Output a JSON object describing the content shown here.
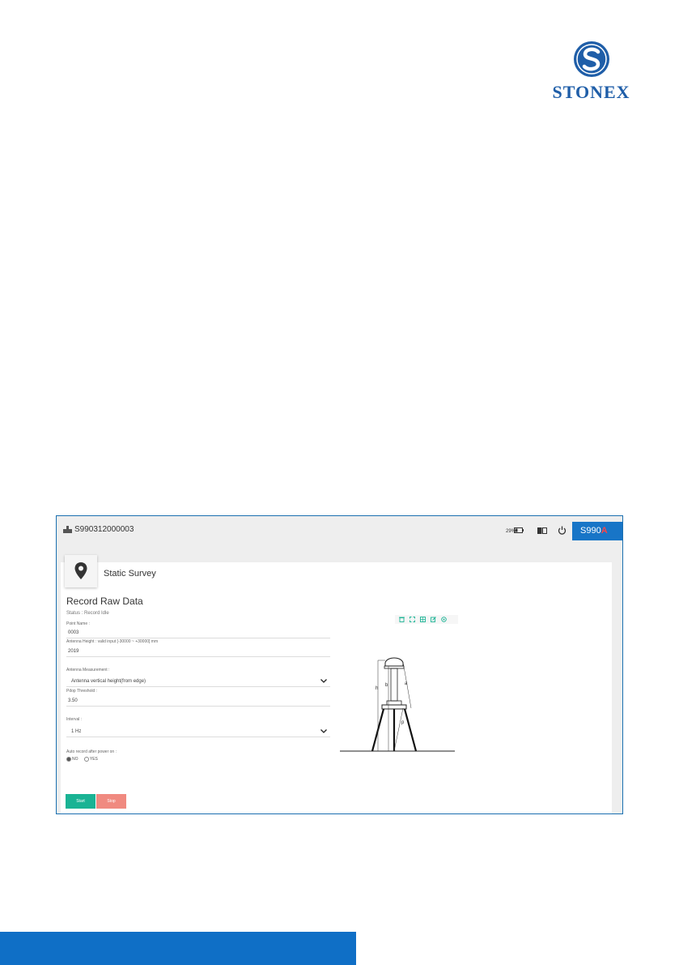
{
  "brand": {
    "name": "STONEX"
  },
  "colors": {
    "brand_blue": "#1f5ea8",
    "accent_blue": "#1875c7",
    "start_green": "#1ab394",
    "stop_red": "#f08a80",
    "footer_blue": "#0f6fc6"
  },
  "app": {
    "device_id": "S990312000003",
    "battery": {
      "percent": "29%"
    },
    "model": {
      "label": "S990",
      "mark": "A"
    },
    "icons": {
      "device": "device-icon",
      "battery": "battery-icon",
      "language": "language-icon",
      "power": "power-icon",
      "page": "location-pin-icon"
    }
  },
  "page": {
    "title": "Static Survey",
    "section_title": "Record Raw Data",
    "status": "Status : Record Idle",
    "fields": {
      "point_name": {
        "label": "Point Name :",
        "value": "0003"
      },
      "antenna_height": {
        "label": "Antenna Height : valid input [-30000 ~ +30000] mm",
        "value": "2019"
      },
      "antenna_measurement": {
        "label": "Antenna Measurement :",
        "value": "Antenna vertical height(from edge)"
      },
      "pdop_threshold": {
        "label": "Pdop Threshold :",
        "value": "3.50"
      },
      "interval": {
        "label": "Interval :",
        "value": "1 Hz"
      }
    },
    "auto_record": {
      "label": "Auto record after power on :",
      "options": [
        "NO",
        "YES"
      ],
      "selected": "NO"
    },
    "buttons": {
      "start": "Start",
      "stop": "Stop"
    },
    "diagram_labels": {
      "h": "h",
      "b": "b",
      "a": "a",
      "p": "p"
    }
  }
}
